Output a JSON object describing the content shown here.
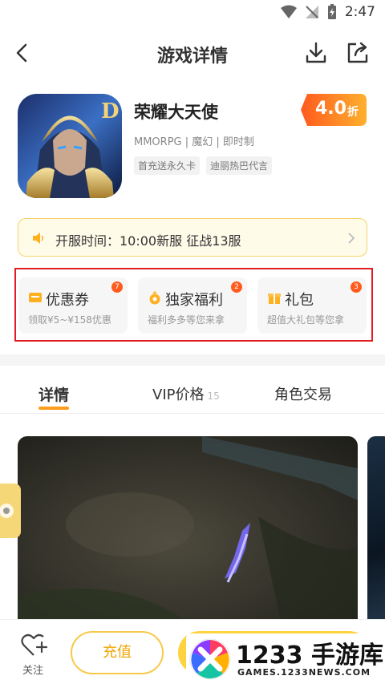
{
  "status_bar": {
    "time": "2:47"
  },
  "nav": {
    "title": "游戏详情"
  },
  "game": {
    "name": "荣耀大天使",
    "meta": "MMORPG | 魔幻 | 即时制",
    "tags": [
      "首充送永久卡",
      "迪丽热巴代言"
    ],
    "discount_value": "4.0",
    "discount_unit": "折"
  },
  "server": {
    "text": "开服时间：10:00新服 征战13服"
  },
  "cards": [
    {
      "title": "优惠券",
      "subtitle": "领取¥5~¥158优惠",
      "badge": "7",
      "icon": "coupon-icon"
    },
    {
      "title": "独家福利",
      "subtitle": "福利多多等您来拿",
      "badge": "2",
      "icon": "bag-icon"
    },
    {
      "title": "礼包",
      "subtitle": "超值大礼包等您拿",
      "badge": "3",
      "icon": "gift-icon"
    }
  ],
  "tabs": [
    {
      "label": "详情"
    },
    {
      "label": "VIP价格",
      "count": "15"
    },
    {
      "label": "角色交易"
    }
  ],
  "bottom": {
    "favorite": "关注",
    "recharge": "充值"
  },
  "watermark": {
    "brand": "1233 手游库",
    "url": "GAMES.1233NEWS.COM"
  },
  "colors": {
    "accent": "#ff9d1b",
    "discount": "#ff7a1a",
    "highlight_box": "#e11d22",
    "button": "#ffd33f"
  }
}
